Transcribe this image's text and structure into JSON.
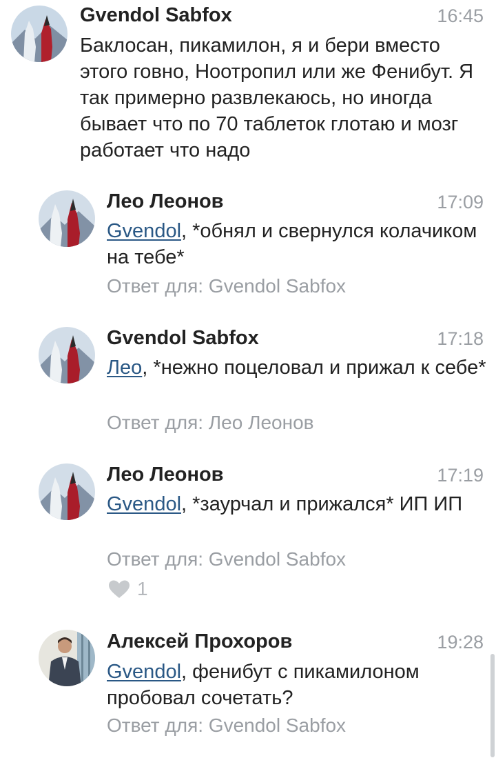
{
  "comments": [
    {
      "author": "Gvendol Sabfox",
      "time": "16:45",
      "text": "Баклосан, пикамилон, я и бери вместо этого говно, Ноотропил или же Фенибут. Я так примерно развлекаюсь, но иногда бывает что по 70 таблеток глотаю и мозг работает что надо"
    },
    {
      "author": "Лео Леонов",
      "time": "17:09",
      "mention": "Gvendol",
      "text": ", *обнял и свернулся колачиком на тебе*",
      "reply": "Ответ для: Gvendol Sabfox"
    },
    {
      "author": "Gvendol Sabfox",
      "time": "17:18",
      "mention": "Лео",
      "text": ", *нежно поцеловал и прижал к себе*",
      "reply": "Ответ для: Лео Леонов"
    },
    {
      "author": "Лео Леонов",
      "time": "17:19",
      "mention": "Gvendol",
      "text": ", *заурчал и прижался* ИП ИП",
      "reply": "Ответ для: Gvendol Sabfox",
      "likes": "1"
    },
    {
      "author": "Алексей Прохоров",
      "time": "19:28",
      "mention": "Gvendol",
      "text": ", фенибут с пикамилоном пробовал сочетать?",
      "reply": "Ответ для: Gvendol Sabfox"
    }
  ],
  "icons": {
    "like": "heart-icon"
  },
  "colors": {
    "mention": "#2a5885",
    "secondary_text": "#9a9ea3",
    "primary_text": "#222222"
  }
}
